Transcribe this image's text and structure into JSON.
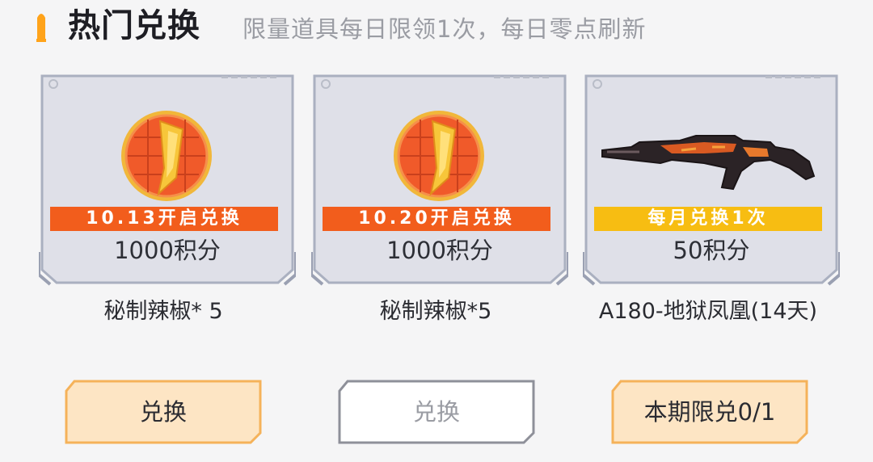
{
  "header": {
    "title": "热门兑换",
    "subtitle": "限量道具每日限领1次，每日零点刷新",
    "accent_color": "#ffa31a"
  },
  "items": [
    {
      "icon": "chili-pepper-coin-icon",
      "banner": "10.13开启兑换",
      "banner_color": "#f25d1c",
      "points": "1000积分",
      "name": "秘制辣椒* 5",
      "button_label": "兑换",
      "button_state": "active"
    },
    {
      "icon": "chili-pepper-coin-icon",
      "banner": "10.20开启兑换",
      "banner_color": "#f25d1c",
      "points": "1000积分",
      "name": "秘制辣椒*5",
      "button_label": "兑换",
      "button_state": "disabled"
    },
    {
      "icon": "rifle-icon",
      "banner": "每月兑换1次",
      "banner_color": "#f7bd12",
      "points": "50积分",
      "name": "A180-地狱凤凰(14天)",
      "button_label": "本期限兑0/1",
      "button_state": "active"
    }
  ]
}
